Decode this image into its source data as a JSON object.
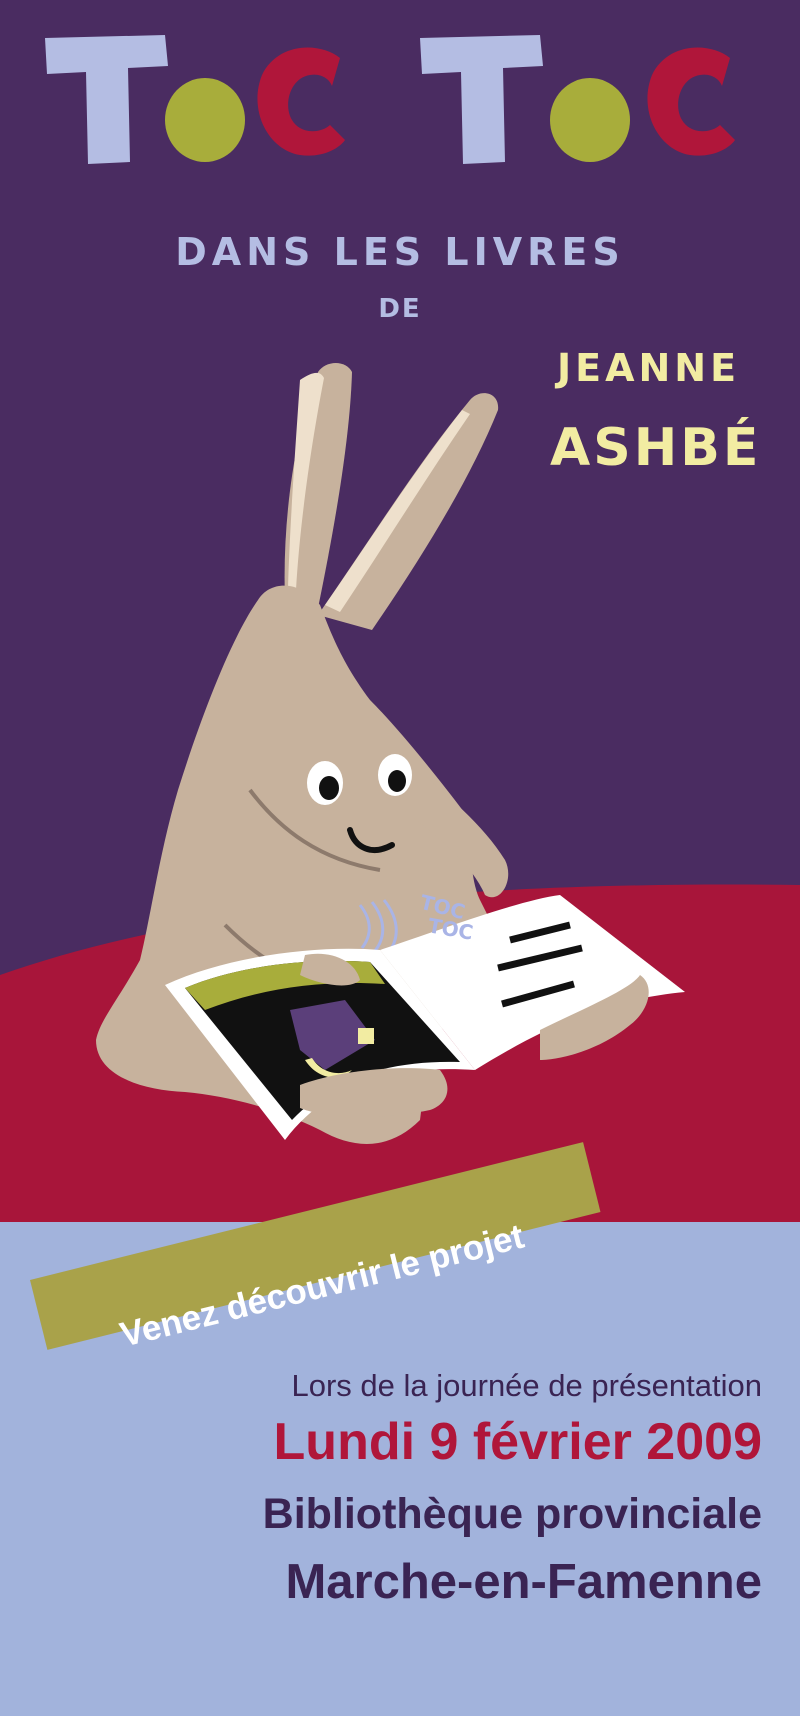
{
  "colors": {
    "background_purple": "#4a2c61",
    "floor_red": "#a8153a",
    "bottom_blue": "#a2b3dc",
    "title_letter_blue": "#b4bde3",
    "title_letter_green": "#a8ad3b",
    "title_letter_red": "#b0163a",
    "author_yellow": "#f2eca2",
    "banner_olive": "#a9a24a",
    "text_dark": "#3a2453",
    "text_red": "#b0163a"
  },
  "poster": {
    "title_words": [
      "Toc",
      "Toc"
    ],
    "subtitle": "DANS LES LIVRES",
    "subtitle_connector": "DE",
    "author_first_name": "JEANNE",
    "author_last_name": "ASHBÉ",
    "book_sound_line1": "TOC",
    "book_sound_line2": "TOC",
    "illustration": "rabbit-reading-book"
  },
  "banner": {
    "label": "Venez découvrir le projet"
  },
  "event": {
    "lead": "Lors de la journée de présentation",
    "date": "Lundi 9 février 2009",
    "place": "Bibliothèque provinciale",
    "city": "Marche-en-Famenne"
  }
}
